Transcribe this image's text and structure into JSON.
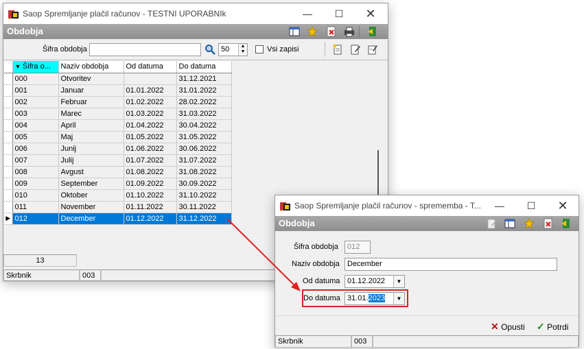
{
  "main_window": {
    "title": "Saop Spremljanje plačil računov - TESTNI UPORABNIk",
    "window_controls": {
      "minimize": "—",
      "maximize": "☐",
      "close": "✕"
    },
    "header_title": "Obdobja",
    "search": {
      "label": "Šifra obdobja",
      "value": "",
      "count": "50",
      "all_records_label": "Vsi zapisi"
    },
    "columns": [
      "Šifra o...",
      "Naziv obdobja",
      "Od datuma",
      "Do datuma"
    ],
    "rows": [
      [
        "000",
        "Otvoritev",
        "",
        "31.12.2021"
      ],
      [
        "001",
        "Januar",
        "01.01.2022",
        "31.01.2022"
      ],
      [
        "002",
        "Februar",
        "01.02.2022",
        "28.02.2022"
      ],
      [
        "003",
        "Marec",
        "01.03.2022",
        "31.03.2022"
      ],
      [
        "004",
        "April",
        "01.04.2022",
        "30.04.2022"
      ],
      [
        "005",
        "Maj",
        "01.05.2022",
        "31.05.2022"
      ],
      [
        "006",
        "Junij",
        "01.06.2022",
        "30.06.2022"
      ],
      [
        "007",
        "Julij",
        "01.07.2022",
        "31.07.2022"
      ],
      [
        "008",
        "Avgust",
        "01.08.2022",
        "31.08.2022"
      ],
      [
        "009",
        "September",
        "01.09.2022",
        "30.09.2022"
      ],
      [
        "010",
        "Oktober",
        "01.10.2022",
        "31.10.2022"
      ],
      [
        "011",
        "November",
        "01.11.2022",
        "30.11.2022"
      ],
      [
        "012",
        "December",
        "01.12.2022",
        "31.12.2022"
      ]
    ],
    "selected_row_index": 12,
    "record_count": "13",
    "status": {
      "module": "Skrbnik",
      "code": "003"
    }
  },
  "edit_window": {
    "title": "Saop Spremljanje plačil računov - sprememba - T...",
    "window_controls": {
      "minimize": "—",
      "maximize": "☐",
      "close": "✕"
    },
    "header_title": "Obdobja",
    "fields": {
      "sifra_label": "Šifra obdobja",
      "sifra_value": "012",
      "naziv_label": "Naziv obdobja",
      "naziv_value": "December",
      "od_label": "Od datuma",
      "od_value": "01.12.2022",
      "do_label": "Do datuma",
      "do_value_prefix": "31.01.",
      "do_value_selected": "2023"
    },
    "buttons": {
      "cancel": "Opusti",
      "confirm": "Potrdi"
    },
    "status": {
      "module": "Skrbnik",
      "code": "003"
    }
  },
  "colors": {
    "selection": "#0078d7",
    "highlight_box": "#e02020",
    "sorted_header": "#00ffff",
    "header_bar": "#9a9a9a"
  }
}
